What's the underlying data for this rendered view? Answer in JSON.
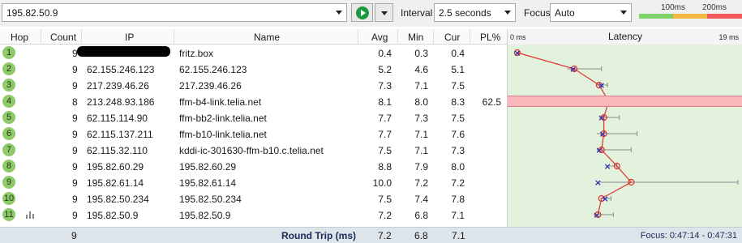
{
  "toolbar": {
    "target": "195.82.50.9",
    "interval_label": "Interval",
    "interval_value": "2.5 seconds",
    "focus_label": "Focus",
    "focus_value": "Auto",
    "legend_100": "100ms",
    "legend_200": "200ms",
    "legend_colors": {
      "good": "#7dd36a",
      "warn": "#f5b942",
      "bad": "#f05a5a"
    },
    "play_icon": "play-icon",
    "play_color": "#1f9a3c"
  },
  "columns": {
    "hop": "Hop",
    "count": "Count",
    "ip": "IP",
    "name": "Name",
    "avg": "Avg",
    "min": "Min",
    "cur": "Cur",
    "pl": "PL%",
    "latency": "Latency",
    "scale_min": "0 ms",
    "scale_max": "19 ms"
  },
  "scale_max_ms": 19,
  "hops": [
    {
      "hop": "1",
      "count": "9",
      "ip": "",
      "name": "fritz.box",
      "avg": "0.4",
      "min": "0.3",
      "cur": "0.4",
      "pl": "",
      "max_ms": 0.5,
      "redacted": true
    },
    {
      "hop": "2",
      "count": "9",
      "ip": "62.155.246.123",
      "name": "62.155.246.123",
      "avg": "5.2",
      "min": "4.6",
      "cur": "5.1",
      "pl": "",
      "max_ms": 7.5
    },
    {
      "hop": "3",
      "count": "9",
      "ip": "217.239.46.26",
      "name": "217.239.46.26",
      "avg": "7.3",
      "min": "7.1",
      "cur": "7.5",
      "pl": "",
      "max_ms": 8.0
    },
    {
      "hop": "4",
      "count": "8",
      "ip": "213.248.93.186",
      "name": "ffm-b4-link.telia.net",
      "avg": "8.1",
      "min": "8.0",
      "cur": "8.3",
      "pl": "62.5",
      "max_ms": 8.3
    },
    {
      "hop": "5",
      "count": "9",
      "ip": "62.115.114.90",
      "name": "ffm-bb2-link.telia.net",
      "avg": "7.7",
      "min": "7.3",
      "cur": "7.5",
      "pl": "",
      "max_ms": 9.0
    },
    {
      "hop": "6",
      "count": "9",
      "ip": "62.115.137.211",
      "name": "ffm-b10-link.telia.net",
      "avg": "7.7",
      "min": "7.1",
      "cur": "7.6",
      "pl": "",
      "max_ms": 10.5
    },
    {
      "hop": "7",
      "count": "9",
      "ip": "62.115.32.110",
      "name": "kddi-ic-301630-ffm-b10.c.telia.net",
      "avg": "7.5",
      "min": "7.1",
      "cur": "7.3",
      "pl": "",
      "max_ms": 10.0
    },
    {
      "hop": "8",
      "count": "9",
      "ip": "195.82.60.29",
      "name": "195.82.60.29",
      "avg": "8.8",
      "min": "7.9",
      "cur": "8.0",
      "pl": "",
      "max_ms": 8.8
    },
    {
      "hop": "9",
      "count": "9",
      "ip": "195.82.61.14",
      "name": "195.82.61.14",
      "avg": "10.0",
      "min": "7.2",
      "cur": "7.2",
      "pl": "",
      "max_ms": 19.0
    },
    {
      "hop": "10",
      "count": "9",
      "ip": "195.82.50.234",
      "name": "195.82.50.234",
      "avg": "7.5",
      "min": "7.4",
      "cur": "7.8",
      "pl": "",
      "max_ms": 8.3
    },
    {
      "hop": "11",
      "count": "9",
      "ip": "195.82.50.9",
      "name": "195.82.50.9",
      "avg": "7.2",
      "min": "6.8",
      "cur": "7.1",
      "pl": "",
      "max_ms": 8.5,
      "last": true
    }
  ],
  "footer": {
    "count": "9",
    "label": "Round Trip (ms)",
    "avg": "7.2",
    "min": "6.8",
    "cur": "7.1",
    "focus": "Focus: 0:47:14 - 0:47:31"
  }
}
